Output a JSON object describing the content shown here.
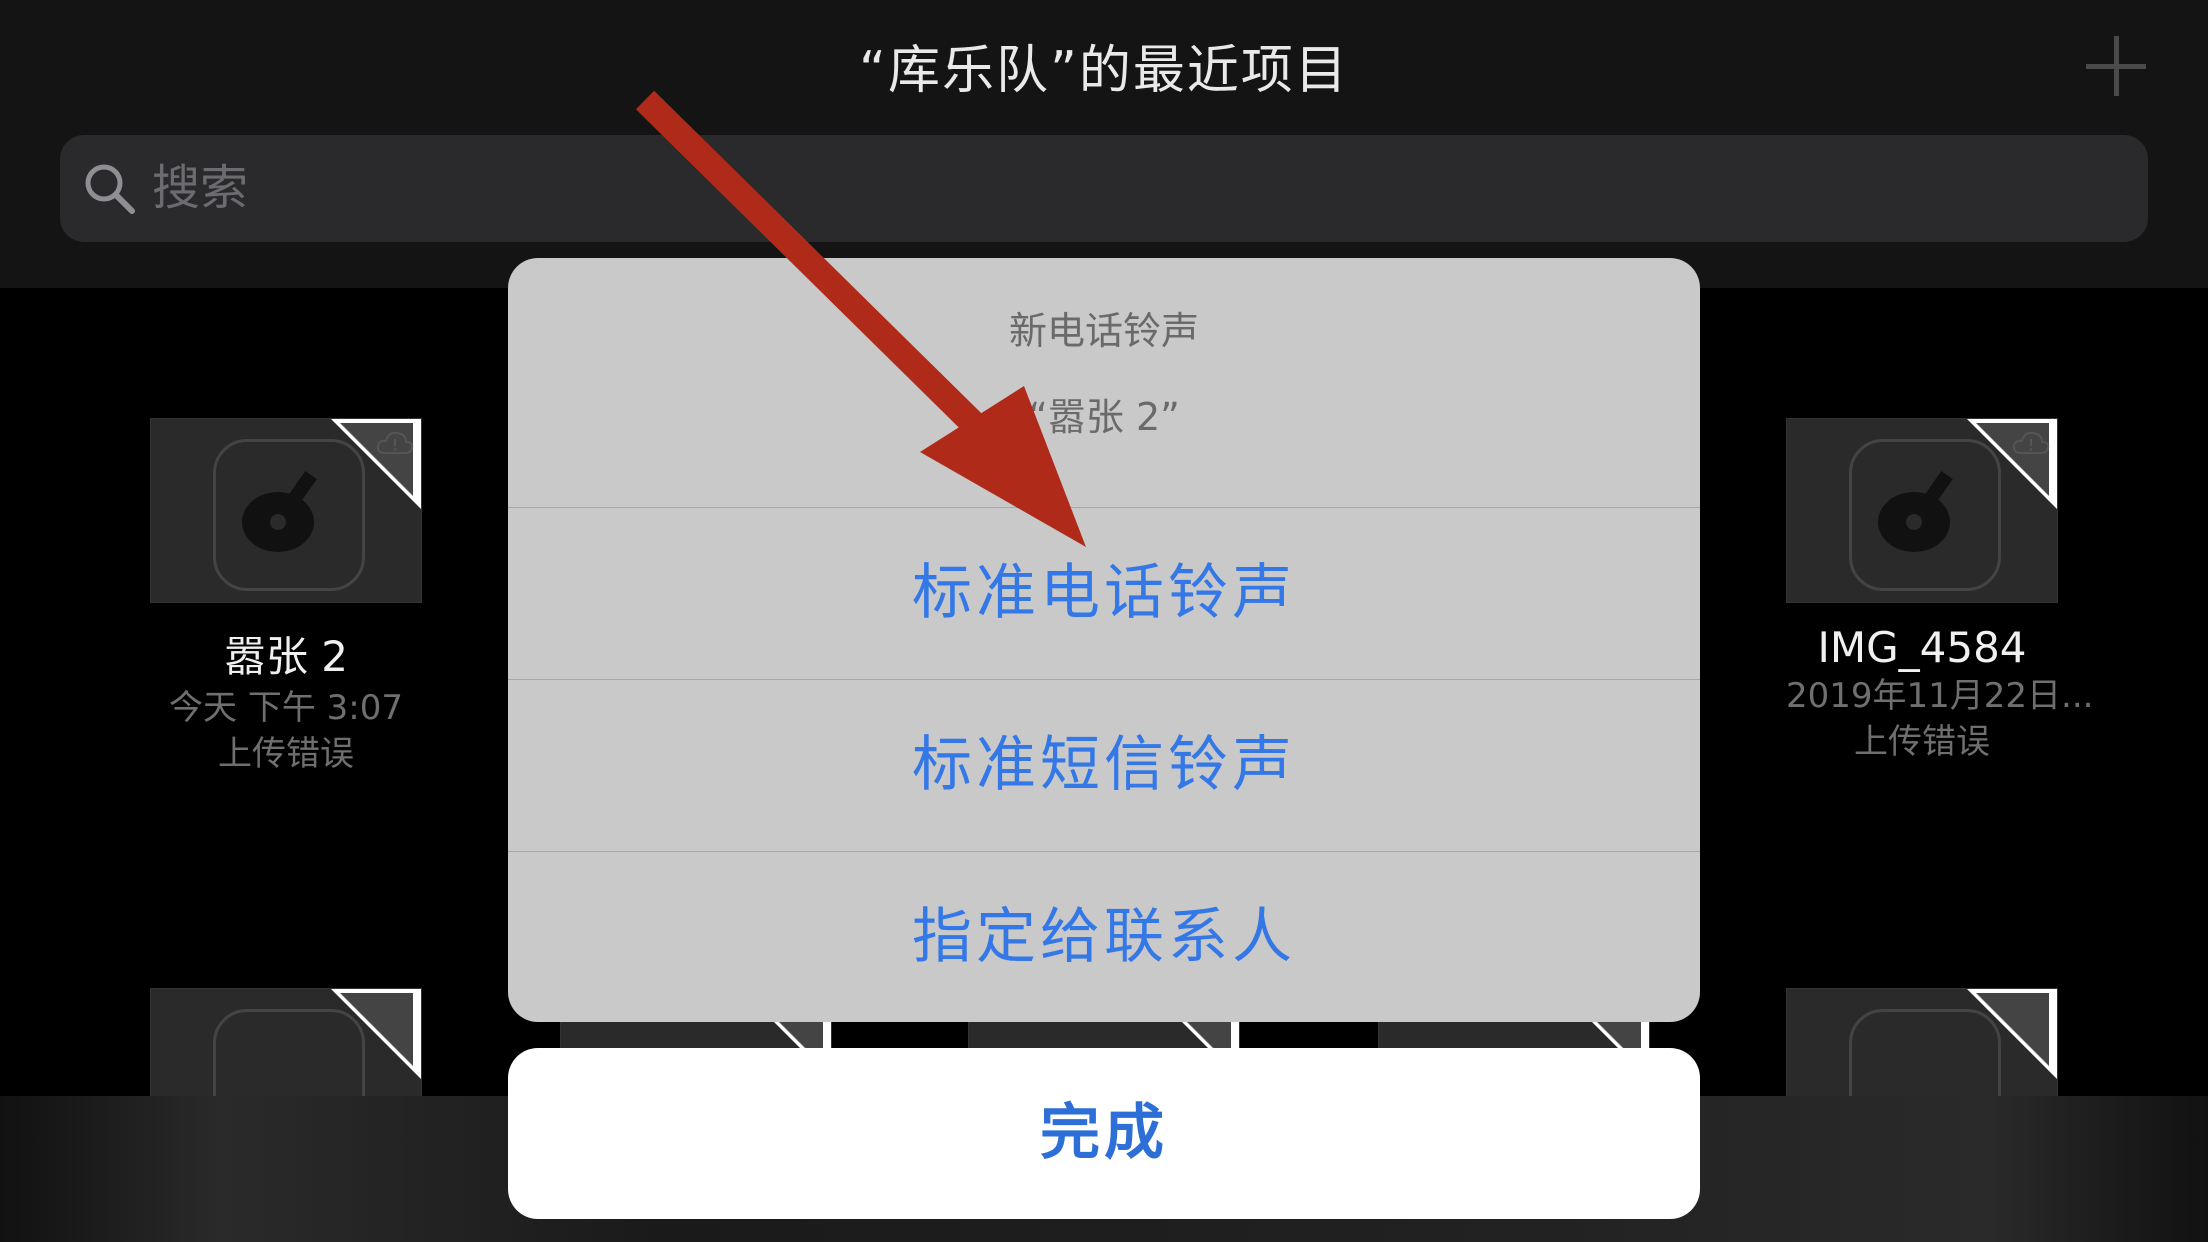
{
  "header": {
    "title": "“库乐队”的最近项目",
    "search_placeholder": "搜索"
  },
  "projects": [
    {
      "name": "嚣张 2",
      "date": "今天 下午 3:07",
      "status": "上传错误"
    },
    {
      "name": "IMG_4584",
      "date": "2019年11月22日...",
      "status": "上传错误"
    }
  ],
  "sheet": {
    "title": "新电话铃声",
    "subtitle": "“嚣张 2”",
    "options": [
      "标准电话铃声",
      "标准短信铃声",
      "指定给联系人"
    ],
    "done_label": "完成"
  },
  "colors": {
    "accent": "#3478e8",
    "arrow": "#b02a1a",
    "sheet_bg": "#c9c9c9"
  },
  "icons": {
    "search": "magnifier",
    "add": "plus",
    "project": "garageband-guitar",
    "cloud": "cloud-error"
  }
}
